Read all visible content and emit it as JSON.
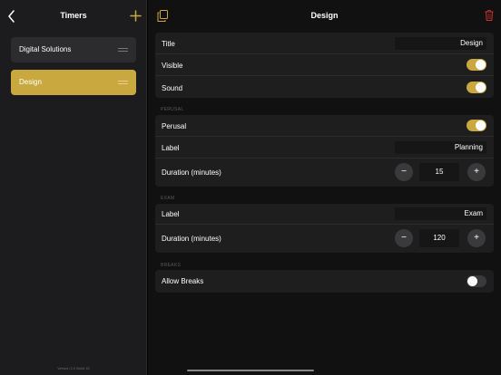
{
  "sidebar": {
    "title": "Timers",
    "items": [
      {
        "label": "Digital Solutions"
      },
      {
        "label": "Design"
      }
    ],
    "version": "Version 2.0 Build 40"
  },
  "main": {
    "title": "Design",
    "general": {
      "title_label": "Title",
      "title_value": "Design",
      "visible_label": "Visible",
      "visible_on": true,
      "sound_label": "Sound",
      "sound_on": true
    },
    "perusal": {
      "header": "PERUSAL",
      "toggle_label": "Perusal",
      "toggle_on": true,
      "label_label": "Label",
      "label_value": "Planning",
      "duration_label": "Duration (minutes)",
      "duration_value": "15"
    },
    "exam": {
      "header": "EXAM",
      "label_label": "Label",
      "label_value": "Exam",
      "duration_label": "Duration (minutes)",
      "duration_value": "120"
    },
    "breaks": {
      "header": "BREAKS",
      "allow_label": "Allow Breaks",
      "allow_on": false
    },
    "stepper": {
      "minus": "−",
      "plus": "+"
    }
  },
  "colors": {
    "accent": "#c9a93f",
    "delete": "#d0312d"
  },
  "icons": [
    "back-chevron-icon",
    "plus-icon",
    "drag-handle-icon",
    "copy-icon",
    "trash-icon"
  ]
}
